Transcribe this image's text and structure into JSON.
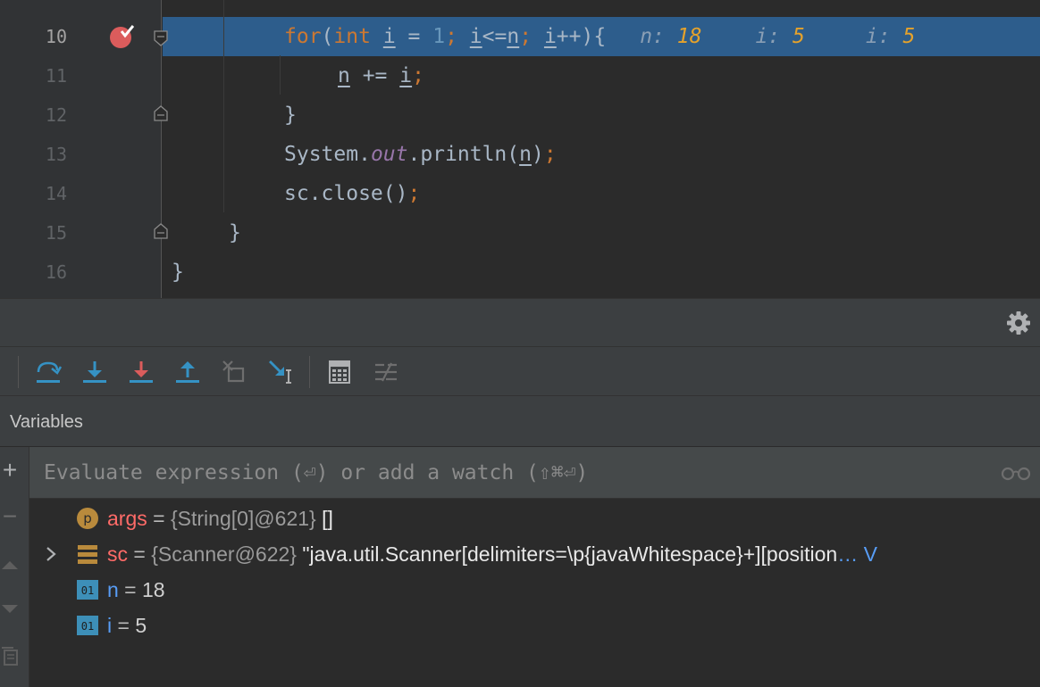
{
  "editor": {
    "lines": [
      {
        "number": "10",
        "current": true
      },
      {
        "number": "11"
      },
      {
        "number": "12"
      },
      {
        "number": "13"
      },
      {
        "number": "14"
      },
      {
        "number": "15"
      },
      {
        "number": "16"
      }
    ],
    "code": {
      "l10": {
        "for": "for",
        "paren_open": "(",
        "int": "int",
        "i_decl": "i",
        "assign": " = ",
        "one": "1",
        "semi1": ";",
        "i_cond": "i",
        "lte": "<=",
        "n_cond": "n",
        "semi2": ";",
        "i_inc": "i",
        "inc": "++){"
      },
      "l11": {
        "n": "n",
        "op": " += ",
        "i": "i",
        "semi": ";"
      },
      "l12": {
        "brace": "}"
      },
      "l13": {
        "system": "System.",
        "out": "out",
        "println": ".println(",
        "n": "n",
        "close": ")",
        "semi": ";"
      },
      "l14": {
        "call": "sc.close()",
        "semi": ";"
      },
      "l15": {
        "brace": "}"
      },
      "l16": {
        "brace": "}"
      }
    },
    "inlays": [
      {
        "name": "n:",
        "value": "18"
      },
      {
        "name": "i:",
        "value": "5"
      },
      {
        "name": "i:",
        "value": "5"
      }
    ]
  },
  "icons": {
    "breakpoint": "breakpoint-hit-icon",
    "settings": "gear-icon",
    "toolbar": [
      "step-over-icon",
      "step-into-icon",
      "force-step-into-icon",
      "step-out-icon",
      "drop-frame-icon",
      "run-to-cursor-icon",
      "evaluate-expression-icon",
      "trace-stream-icon"
    ],
    "glasses": "glasses-icon"
  },
  "colors": {
    "execution_line": "#2d5d8c",
    "breakpoint": "#db5c5c",
    "keyword": "#cc7832",
    "number": "#6897bb",
    "inlay_value": "#e5a22b",
    "var_name_red": "#ff6b68",
    "var_name_blue": "#589df6"
  },
  "variables": {
    "title": "Variables",
    "watch_placeholder": "Evaluate expression (⏎) or add a watch (⇧⌘⏎)",
    "items": [
      {
        "icon": "p",
        "name": "args",
        "eq": " = ",
        "type": "{String[0]@621}",
        "value": " []"
      },
      {
        "icon": "field",
        "name": "sc",
        "eq": " = ",
        "type": "{Scanner@622}",
        "value": " \"java.util.Scanner[delimiters=\\p{javaWhitespace}+][position",
        "more": "… V"
      },
      {
        "icon": "01",
        "name": "n",
        "eq": " = ",
        "value": "18"
      },
      {
        "icon": "01",
        "name": "i",
        "eq": " = ",
        "value": "5"
      }
    ]
  },
  "side_tools": {
    "add": "+",
    "remove": "−"
  }
}
